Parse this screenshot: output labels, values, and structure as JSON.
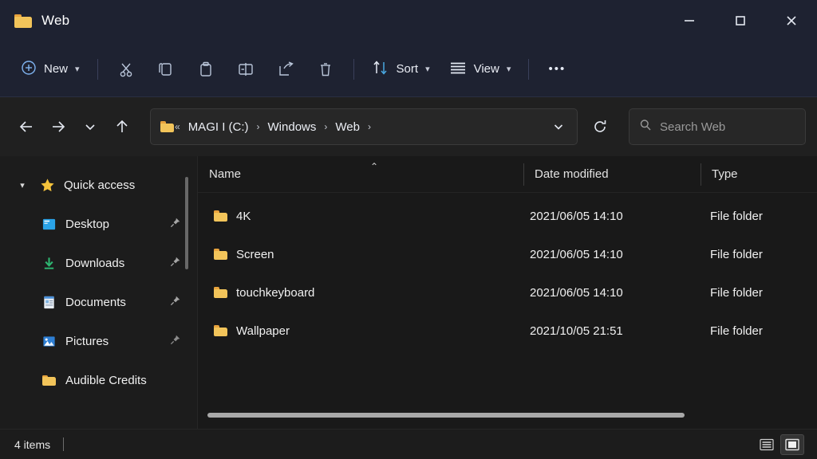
{
  "window": {
    "title": "Web",
    "title_icon": "folder-icon",
    "controls": {
      "minimize": "minimize-icon",
      "maximize": "maximize-icon",
      "close": "close-icon"
    }
  },
  "toolbar": {
    "new_label": "New",
    "new_icon": "plus-circle-icon",
    "sort_label": "Sort",
    "sort_icon": "sort-arrows-icon",
    "view_label": "View",
    "view_icon": "list-lines-icon",
    "icons": [
      {
        "name": "cut-icon",
        "title": "Cut"
      },
      {
        "name": "copy-icon",
        "title": "Copy"
      },
      {
        "name": "paste-icon",
        "title": "Paste"
      },
      {
        "name": "rename-icon",
        "title": "Rename"
      },
      {
        "name": "share-icon",
        "title": "Share"
      },
      {
        "name": "delete-icon",
        "title": "Delete"
      }
    ],
    "overflow_label": "•••"
  },
  "navigation": {
    "back_icon": "arrow-left-icon",
    "forward_icon": "arrow-right-icon",
    "recent_icon": "chevron-down-icon",
    "up_icon": "arrow-up-icon",
    "refresh_icon": "refresh-icon"
  },
  "address": {
    "folder_icon": "folder-icon",
    "overflow": "«",
    "crumbs": [
      "MAGI I (C:)",
      "Windows",
      "Web"
    ],
    "separator": "›",
    "trailing_separator": "›",
    "dropdown_icon": "chevron-down-icon"
  },
  "search": {
    "icon": "search-icon",
    "placeholder": "Search Web",
    "value": ""
  },
  "sidebar": {
    "items": [
      {
        "label": "Quick access",
        "icon": "star-icon",
        "expanded": true,
        "pinned": false,
        "indent": false
      },
      {
        "label": "Desktop",
        "icon": "desktop-icon",
        "pinned": true,
        "indent": true
      },
      {
        "label": "Downloads",
        "icon": "downloads-icon",
        "pinned": true,
        "indent": true
      },
      {
        "label": "Documents",
        "icon": "documents-icon",
        "pinned": true,
        "indent": true
      },
      {
        "label": "Pictures",
        "icon": "pictures-icon",
        "pinned": true,
        "indent": true
      },
      {
        "label": "Audible Credits",
        "icon": "folder-icon",
        "pinned": false,
        "indent": true
      }
    ]
  },
  "file_list": {
    "columns": [
      {
        "key": "name",
        "label": "Name",
        "sorted": "ascending"
      },
      {
        "key": "date",
        "label": "Date modified",
        "sorted": ""
      },
      {
        "key": "type",
        "label": "Type",
        "sorted": ""
      }
    ],
    "sort_caret": "⌃",
    "rows": [
      {
        "icon": "folder-icon",
        "name": "4K",
        "date": "2021/06/05 14:10",
        "type": "File folder"
      },
      {
        "icon": "folder-icon",
        "name": "Screen",
        "date": "2021/06/05 14:10",
        "type": "File folder"
      },
      {
        "icon": "folder-icon",
        "name": "touchkeyboard",
        "date": "2021/06/05 14:10",
        "type": "File folder"
      },
      {
        "icon": "folder-icon",
        "name": "Wallpaper",
        "date": "2021/10/05 21:51",
        "type": "File folder"
      }
    ]
  },
  "status": {
    "item_count": "4 items",
    "details_view_icon": "details-view-icon",
    "large_icons_view_icon": "large-icons-view-icon"
  },
  "colors": {
    "titlebar": "#1e2231",
    "toolbar": "#1e2231",
    "navbar": "#202020",
    "sidebar": "#1c1c1c",
    "content": "#191919",
    "folder_accent": "#f2c45a",
    "star_accent": "#f5c33b",
    "text": "#f0f0f0"
  }
}
